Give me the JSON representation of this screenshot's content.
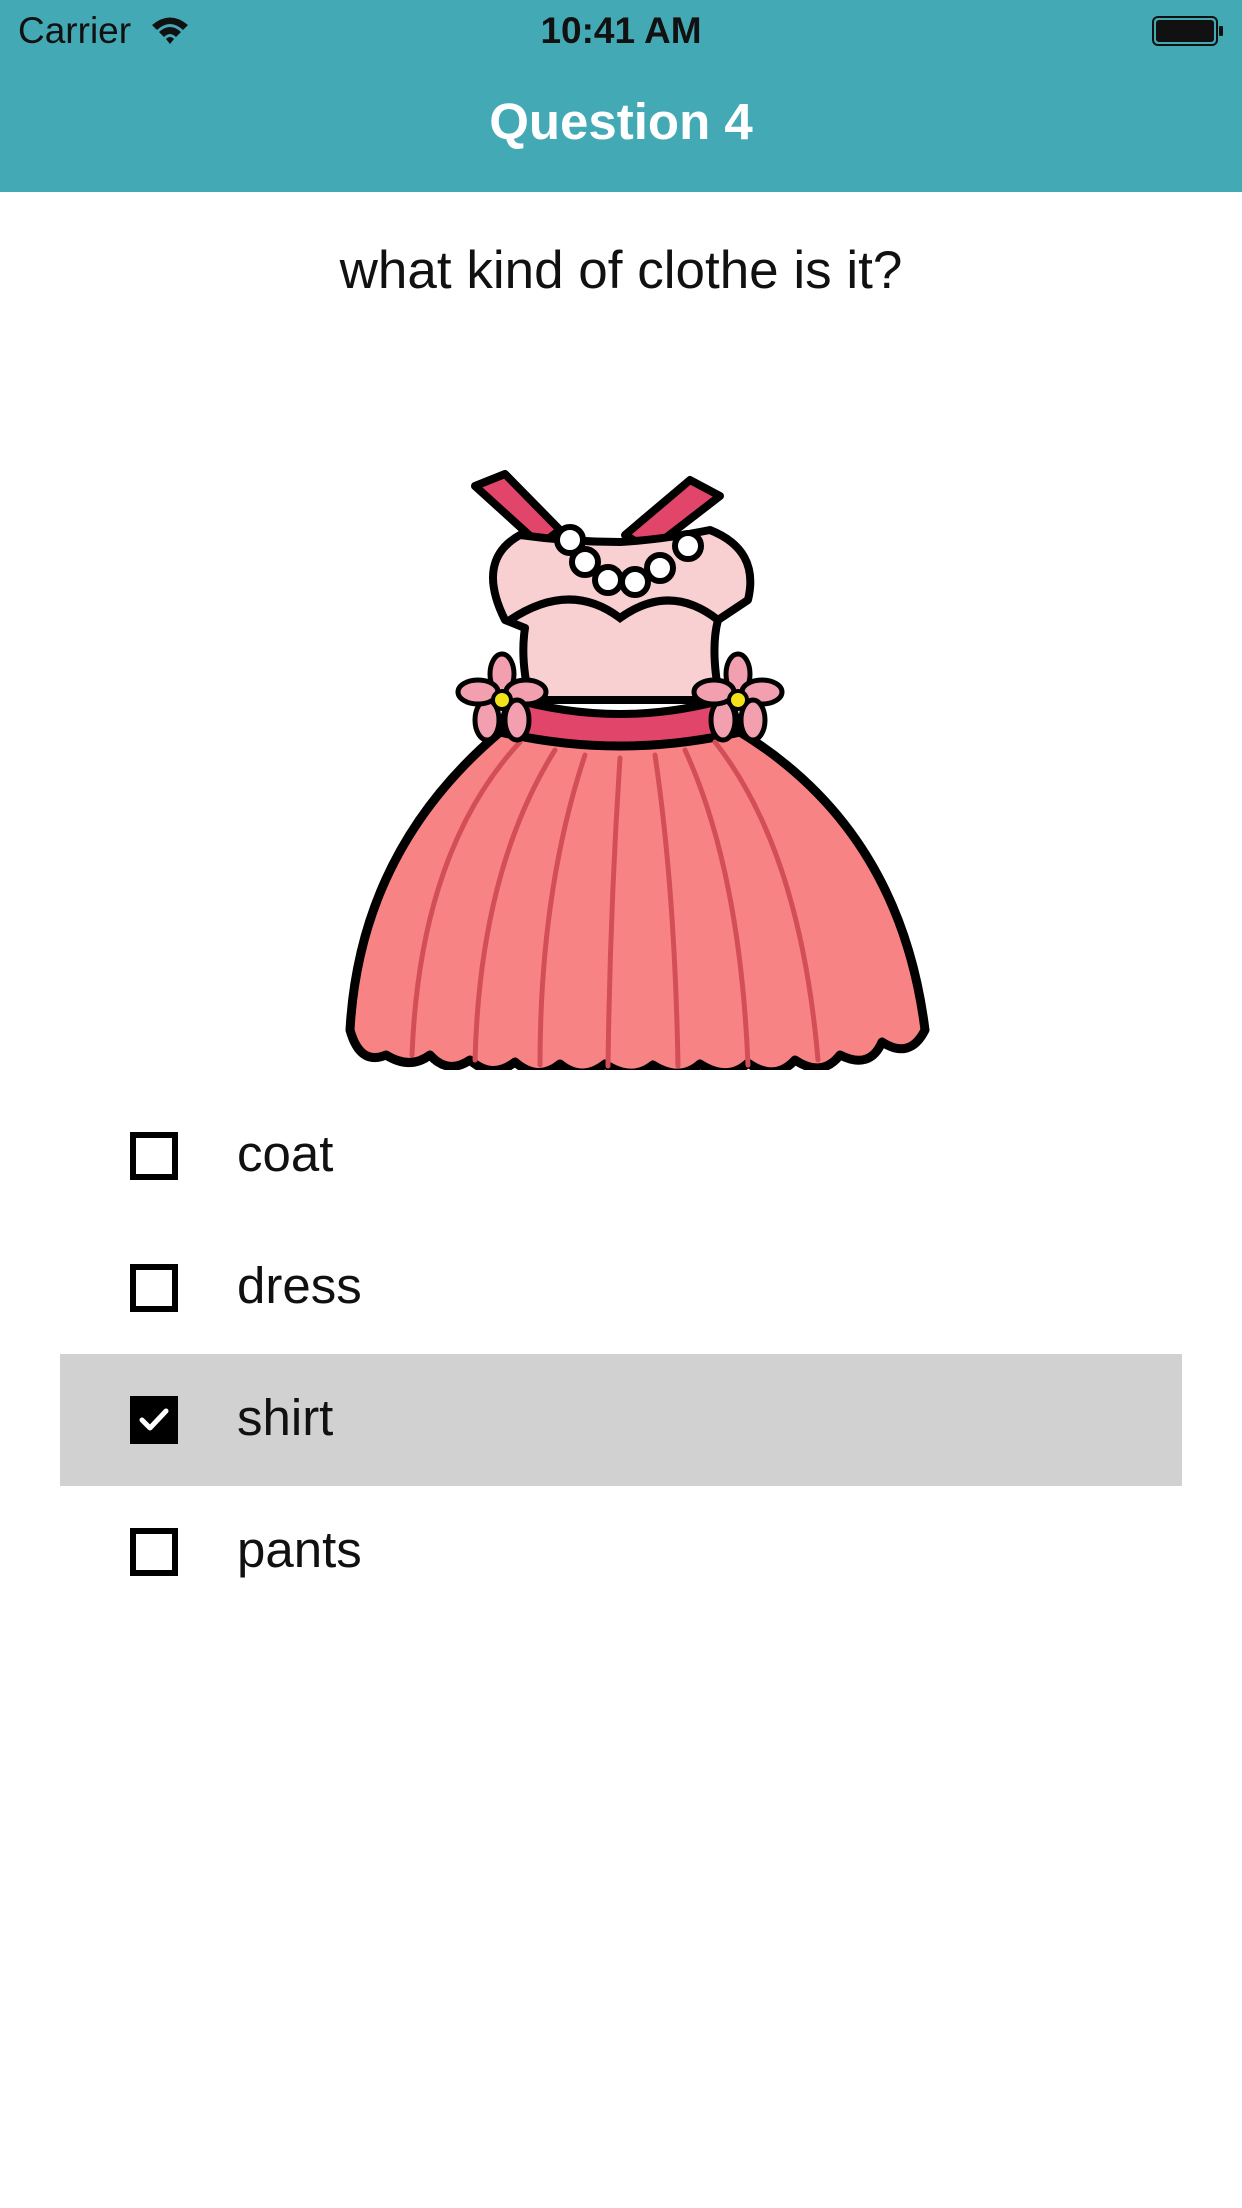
{
  "status_bar": {
    "carrier": "Carrier",
    "time": "10:41 AM",
    "wifi_icon": "wifi-icon",
    "battery_icon": "battery-full-icon"
  },
  "nav": {
    "title": "Question 4",
    "bar_color": "#43a9b5"
  },
  "question": {
    "text": "what kind of clothe is it?",
    "image_icon": "dress-illustration"
  },
  "options": [
    {
      "label": "coat",
      "checked": false
    },
    {
      "label": "dress",
      "checked": false
    },
    {
      "label": "shirt",
      "checked": true
    },
    {
      "label": "pants",
      "checked": false
    }
  ],
  "colors": {
    "selected_row": "#d1d1d1",
    "dress_skirt": "#f88384",
    "dress_bodice": "#f9d0d1",
    "dress_trim": "#e2456a"
  }
}
